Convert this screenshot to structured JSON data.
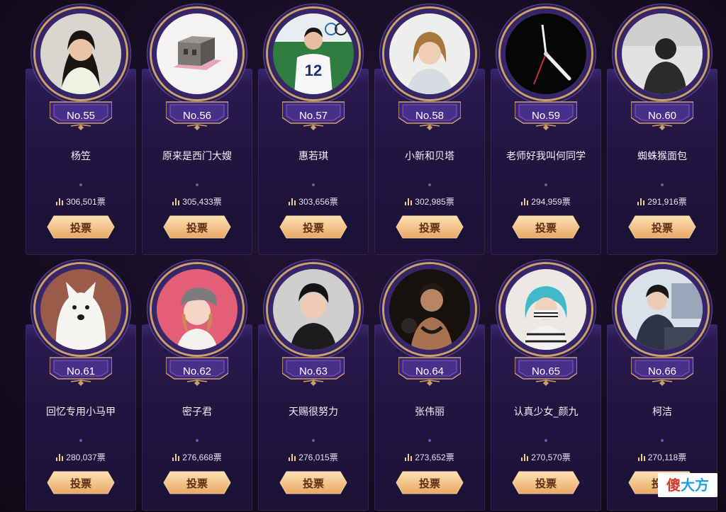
{
  "button_label": "投票",
  "vote_suffix": "票",
  "contestants": [
    {
      "number": "No.55",
      "name": "杨笠",
      "votes": "306,501",
      "avatar": "woman-long-hair-portrait"
    },
    {
      "number": "No.56",
      "name": "原来是西门大嫂",
      "votes": "305,433",
      "avatar": "building-model"
    },
    {
      "number": "No.57",
      "name": "惠若琪",
      "votes": "303,656",
      "avatar": "volleyball-player-jersey-12"
    },
    {
      "number": "No.58",
      "name": "小新和贝塔",
      "votes": "302,985",
      "avatar": "woman-short-hair-portrait"
    },
    {
      "number": "No.59",
      "name": "老师好我叫何同学",
      "votes": "294,959",
      "avatar": "clock-hands-on-black"
    },
    {
      "number": "No.60",
      "name": "蜘蛛猴面包",
      "votes": "291,916",
      "avatar": "silhouette-grayscale"
    },
    {
      "number": "No.61",
      "name": "回忆专用小马甲",
      "votes": "280,037",
      "avatar": "white-dog"
    },
    {
      "number": "No.62",
      "name": "密子君",
      "votes": "276,668",
      "avatar": "woman-in-cap"
    },
    {
      "number": "No.63",
      "name": "天赐很努力",
      "votes": "276,015",
      "avatar": "young-man-portrait"
    },
    {
      "number": "No.64",
      "name": "张伟丽",
      "votes": "273,652",
      "avatar": "fighter-with-gloves"
    },
    {
      "number": "No.65",
      "name": "认真少女_颜九",
      "votes": "270,570",
      "avatar": "blue-hair-masked-girl"
    },
    {
      "number": "No.66",
      "name": "柯洁",
      "votes": "270,118",
      "avatar": "man-at-desk"
    }
  ],
  "watermark": {
    "part1": "傻",
    "part2": "大方"
  },
  "colors": {
    "gold": "#caa06b",
    "button_gold": "#f2c98f",
    "button_text": "#5b2e12",
    "card_purple": "#211540",
    "badge_purple": "#4a2f8a"
  }
}
